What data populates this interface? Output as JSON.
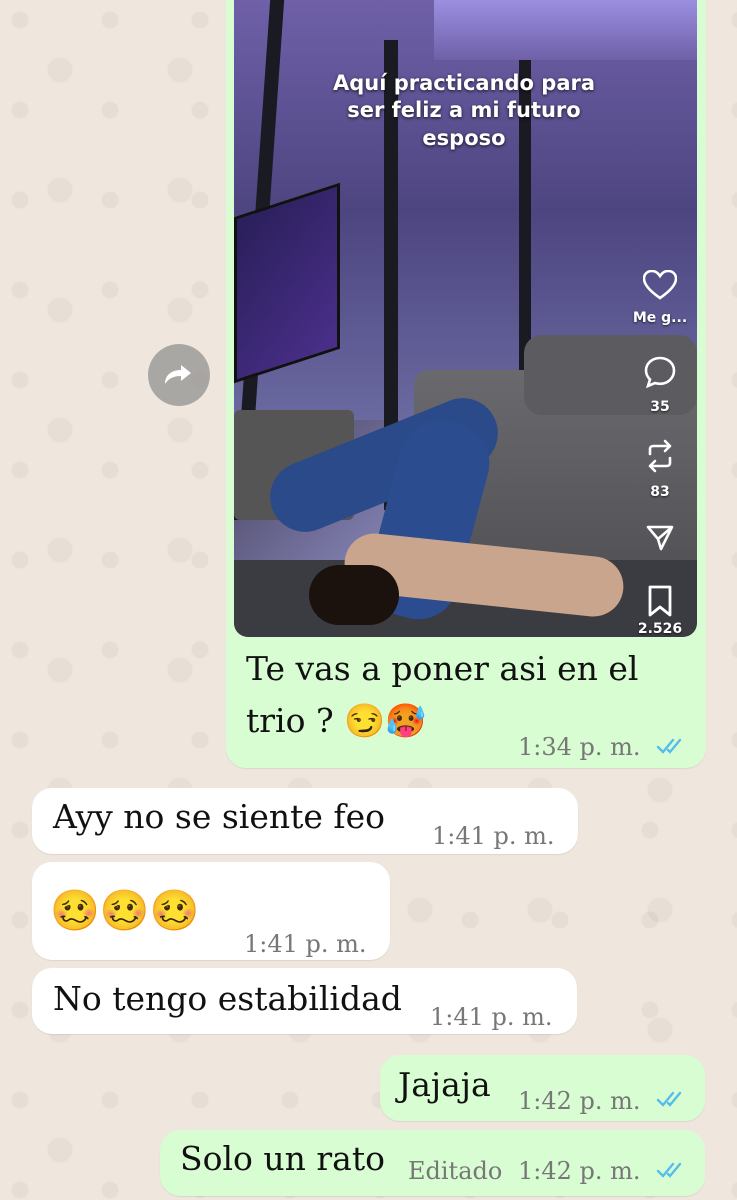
{
  "video": {
    "caption": "Aquí practicando para ser feliz a mi futuro esposo",
    "like_label": "Me g...",
    "comments_count": "35",
    "shares_count": "83",
    "saves_count": "2.526"
  },
  "messages": [
    {
      "text": "Te vas a poner asi en el",
      "text2": "trio ? 😏🥵",
      "time": "1:34 p. m."
    },
    {
      "text": "Ayy no se siente feo",
      "time": "1:41 p. m."
    },
    {
      "text": "🥴🥴🥴",
      "time": "1:41 p. m."
    },
    {
      "text": "No tengo estabilidad",
      "time": "1:41 p. m."
    },
    {
      "text": "Jajaja",
      "time": "1:42 p. m."
    },
    {
      "text": "Solo un rato",
      "edited": "Editado",
      "time": "1:42 p. m."
    }
  ],
  "colors": {
    "outgoing": "#d9fdd3",
    "incoming": "#ffffff",
    "read_ticks": "#53bdeb",
    "background": "#efe7dd"
  },
  "icons": [
    "forward-icon",
    "heart-icon",
    "comment-icon",
    "repost-icon",
    "send-icon",
    "bookmark-icon",
    "double-check-icon"
  ]
}
